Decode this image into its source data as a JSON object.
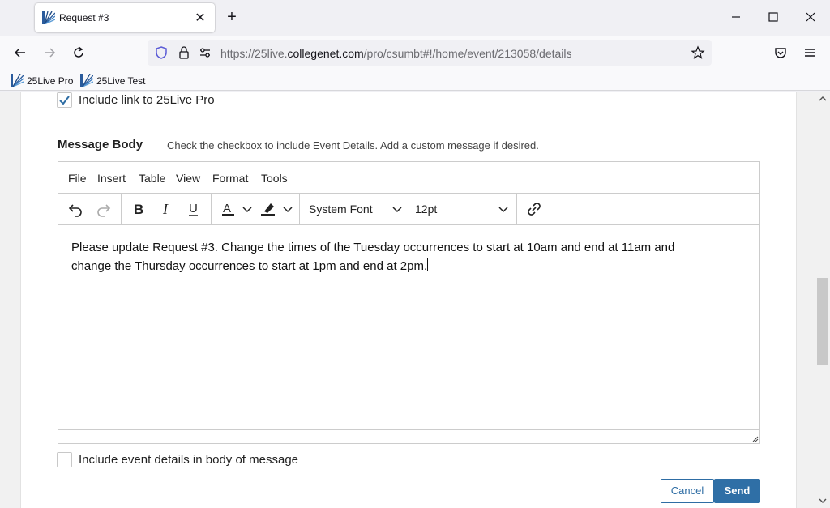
{
  "browser": {
    "tab_title": "Request #3",
    "url_prefix": "https://25live.",
    "url_host": "collegenet.com",
    "url_path": "/pro/csumbt#!/home/event/213058/details",
    "bookmarks": [
      {
        "label": "25Live Pro",
        "icon": "25live-logo-icon"
      },
      {
        "label": "25Live Test",
        "icon": "25live-logo-icon"
      }
    ]
  },
  "form": {
    "include_link_label": "Include link to 25Live Pro",
    "include_link_checked": true,
    "message_body_title": "Message Body",
    "message_body_hint": "Check the checkbox to include Event Details. Add a custom message if desired.",
    "editor": {
      "menus": [
        "File",
        "Insert",
        "Table",
        "View",
        "Format",
        "Tools"
      ],
      "font_family": "System Font",
      "font_size": "12pt",
      "content_line1": "Please update Request #3. Change the times of the Tuesday occurrences to start at 10am and end at 11am and",
      "content_line2": "change the Thursday occurrences to start at 1pm and end at 2pm."
    },
    "include_details_label": "Include event details in body of message",
    "include_details_checked": false,
    "cancel_label": "Cancel",
    "send_label": "Send"
  },
  "colors": {
    "accent": "#2f6fa6",
    "checkmark": "#2e6da4"
  }
}
